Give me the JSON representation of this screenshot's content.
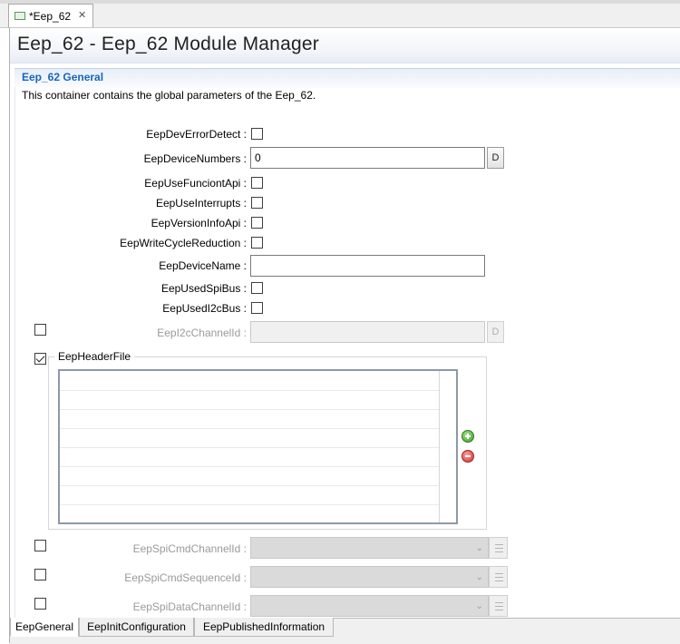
{
  "tab": {
    "label": "*Eep_62",
    "close": "✕"
  },
  "header": {
    "title": "Eep_62 - Eep_62 Module Manager"
  },
  "section": {
    "title": "Eep_62 General",
    "description": "This container contains the global parameters of the Eep_62."
  },
  "fields": {
    "dev_error_detect": {
      "label": "EepDevErrorDetect :",
      "checked": false
    },
    "device_numbers": {
      "label": "EepDeviceNumbers :",
      "value": "0",
      "button": "D"
    },
    "use_funciont_api": {
      "label": "EepUseFunciontApi :",
      "checked": false
    },
    "use_interrupts": {
      "label": "EepUseInterrupts :",
      "checked": false
    },
    "version_info_api": {
      "label": "EepVersionInfoApi :",
      "checked": false
    },
    "write_cycle_reduction": {
      "label": "EepWriteCycleReduction :",
      "checked": false
    },
    "device_name": {
      "label": "EepDeviceName :",
      "value": ""
    },
    "used_spi_bus": {
      "label": "EepUsedSpiBus :",
      "checked": false
    },
    "used_i2c_bus": {
      "label": "EepUsedI2cBus :",
      "checked": false
    },
    "i2c_channel_id": {
      "label": "EepI2cChannelId :",
      "value": "",
      "button": "D",
      "enabled": false
    },
    "header_file": {
      "label": "EepHeaderFile",
      "enabled": true
    },
    "spi_cmd_channel_id": {
      "label": "EepSpiCmdChannelId :",
      "enabled": false
    },
    "spi_cmd_sequence_id": {
      "label": "EepSpiCmdSequenceId :",
      "enabled": false
    },
    "spi_data_channel_id": {
      "label": "EepSpiDataChannelId :",
      "enabled": false
    }
  },
  "bottom_tabs": [
    {
      "label": "EepGeneral",
      "active": true
    },
    {
      "label": "EepInitConfiguration",
      "active": false
    },
    {
      "label": "EepPublishedInformation",
      "active": false
    }
  ],
  "colors": {
    "section_title": "#1565c0",
    "add_button": "#3f9a2a",
    "remove_button": "#d23333"
  }
}
